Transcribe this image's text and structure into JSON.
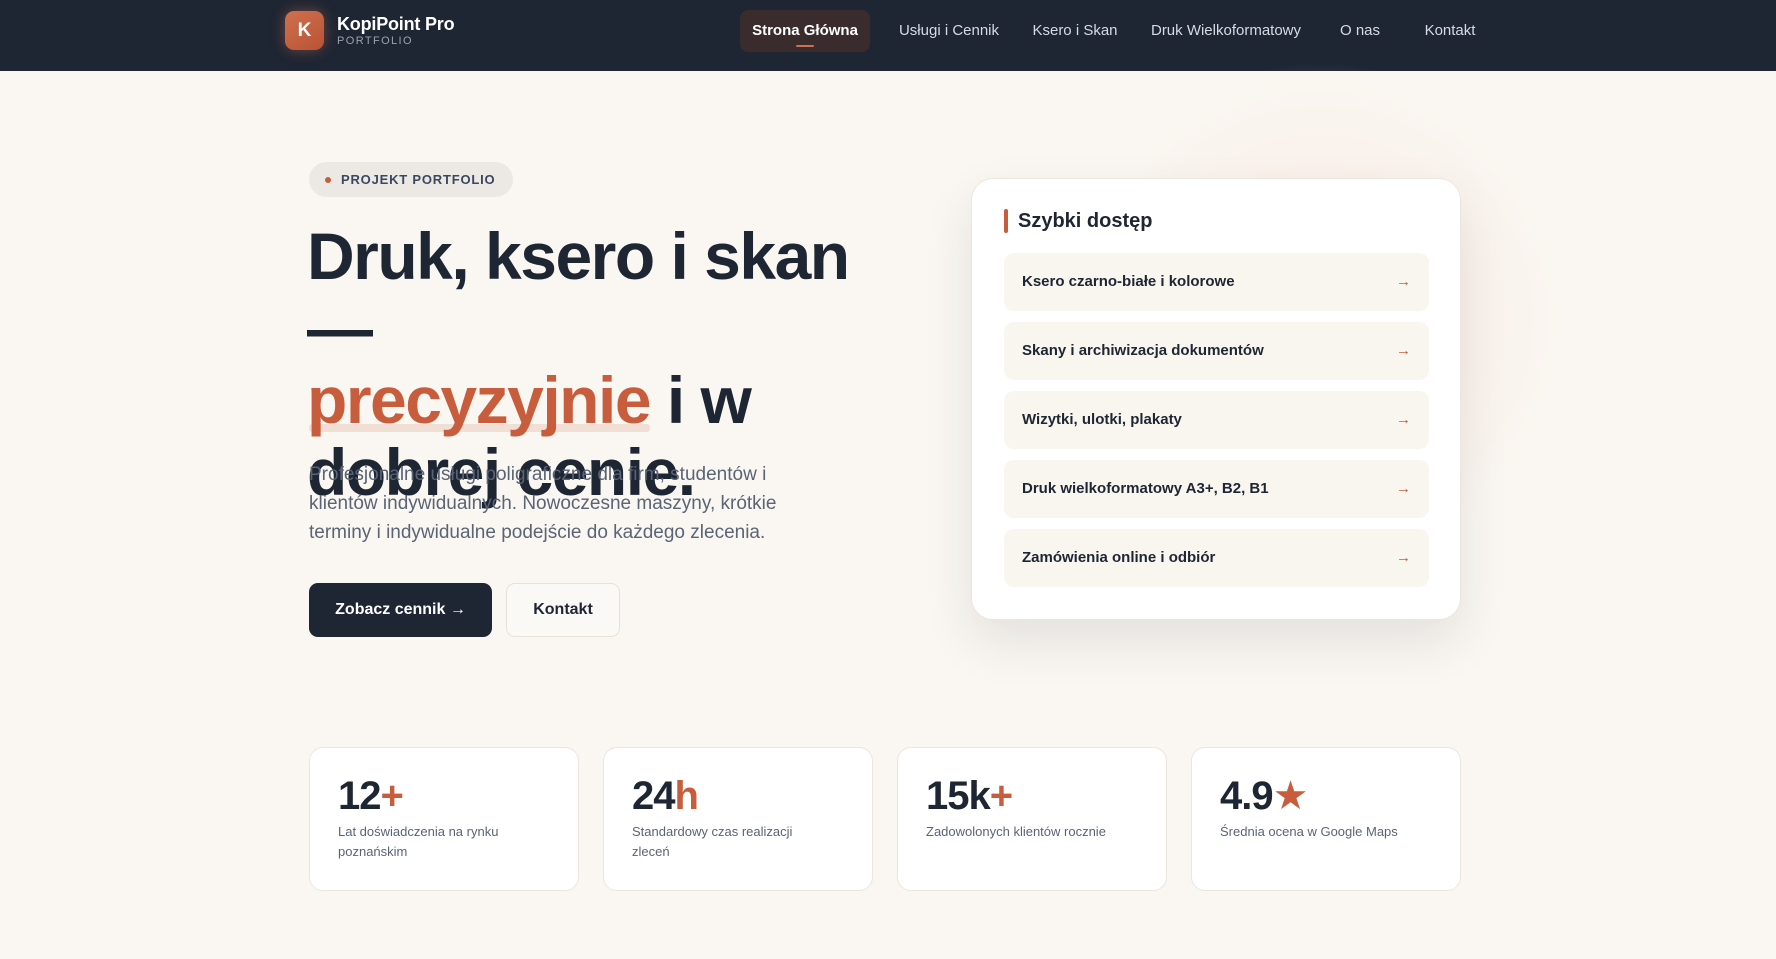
{
  "header": {
    "logo_letter": "K",
    "brand": "KopiPoint Pro",
    "brand_sub": "PORTFOLIO",
    "nav": [
      {
        "label": "Strona Główna",
        "active": true
      },
      {
        "label": "Usługi i Cennik",
        "active": false
      },
      {
        "label": "Ksero i Skan",
        "active": false
      },
      {
        "label": "Druk Wielkoformatowy",
        "active": false
      },
      {
        "label": "O nas",
        "active": false
      },
      {
        "label": "Kontakt",
        "active": false
      }
    ]
  },
  "hero": {
    "pill": "PROJEKT PORTFOLIO",
    "headline_part1": "Druk, ksero i skan —",
    "headline_accent": "precyzyjnie",
    "headline_part2": " i w",
    "headline_part3": "dobrej cenie.",
    "lead": "Profesjonalne usługi poligraficzne dla firm, studentów i klientów indywidualnych. Nowoczesne maszyny, krótkie terminy i indywidualne podejście do każdego zlecenia.",
    "cta_primary": "Zobacz cennik →",
    "cta_secondary": "Kontakt"
  },
  "quick_access": {
    "title": "Szybki dostęp",
    "items": [
      {
        "label": "Ksero czarno-białe i kolorowe",
        "arrow": "→"
      },
      {
        "label": "Skany i archiwizacja dokumentów",
        "arrow": "→"
      },
      {
        "label": "Wizytki, ulotki, plakaty",
        "arrow": "→"
      },
      {
        "label": "Druk wielkoformatowy A3+, B2, B1",
        "arrow": "→"
      },
      {
        "label": "Zamówienia online i odbiór",
        "arrow": "→"
      }
    ]
  },
  "stats": [
    {
      "value": "12",
      "suffix": "+",
      "desc": "Lat doświadczenia na rynku poznańskim"
    },
    {
      "value": "24",
      "suffix": "h",
      "desc": "Standardowy czas realizacji zleceń"
    },
    {
      "value": "15k",
      "suffix": "+",
      "desc": "Zadowolonych klientów rocznie"
    },
    {
      "value": "4.9",
      "suffix": "★",
      "desc": "Średnia ocena w Google Maps"
    }
  ],
  "colors": {
    "accent": "#c75d3c",
    "dark": "#1e2533",
    "background": "#faf7f2"
  }
}
